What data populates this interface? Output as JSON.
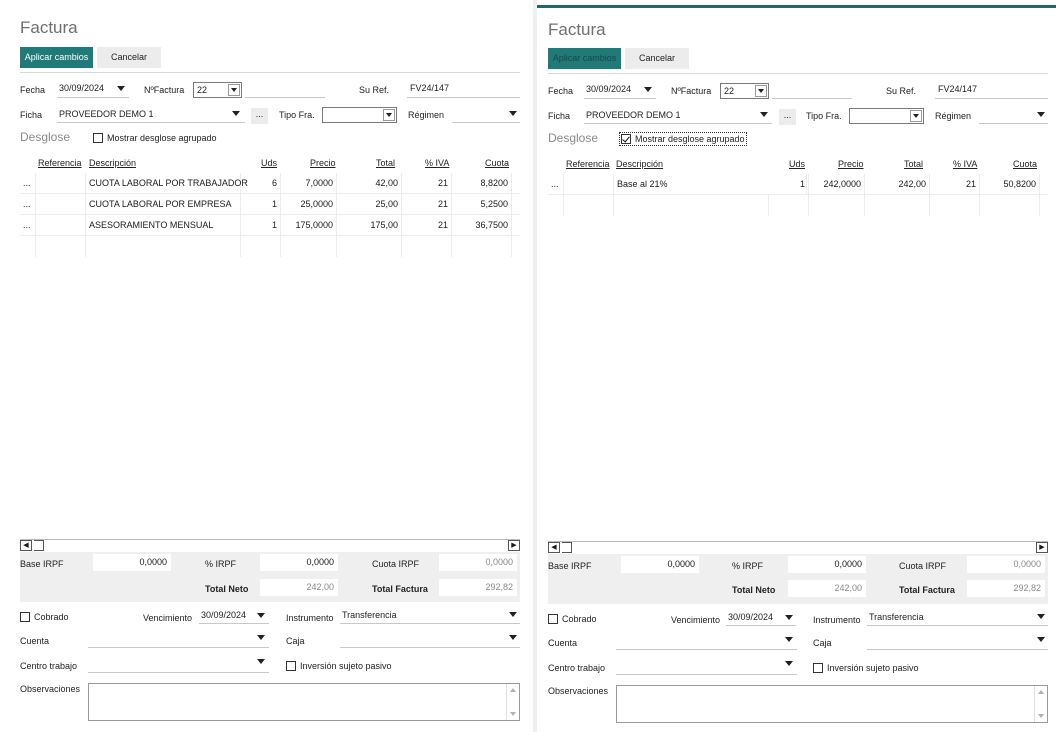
{
  "left": {
    "title": "Factura",
    "apply_label": "Aplicar cambios",
    "cancel_label": "Cancelar",
    "fecha_label": "Fecha",
    "fecha_value": "30/09/2024",
    "nfactura_label": "NºFactura",
    "nfactura_value": "22",
    "suref_label": "Su Ref.",
    "suref_value": "FV24/147",
    "ficha_label": "Ficha",
    "ficha_value": "PROVEEDOR DEMO 1",
    "dots": "...",
    "tipofra_label": "Tipo Fra.",
    "regimen_label": "Régimen",
    "desglose_label": "Desglose",
    "mostrar_label": "Mostrar desglose agrupado",
    "headers": {
      "ref": "Referencia",
      "desc": "Descripción",
      "uds": "Uds",
      "precio": "Precio",
      "total": "Total",
      "iva": "% IVA",
      "cuota": "Cuota"
    },
    "rows": [
      {
        "dots": "...",
        "desc": "CUOTA LABORAL POR TRABAJADOR",
        "uds": "6",
        "precio": "7,0000",
        "total": "42,00",
        "iva": "21",
        "cuota": "8,8200"
      },
      {
        "dots": "...",
        "desc": "CUOTA LABORAL POR EMPRESA",
        "uds": "1",
        "precio": "25,0000",
        "total": "25,00",
        "iva": "21",
        "cuota": "5,2500"
      },
      {
        "dots": "...",
        "desc": "ASESORAMIENTO MENSUAL",
        "uds": "1",
        "precio": "175,0000",
        "total": "175,00",
        "iva": "21",
        "cuota": "36,7500"
      }
    ],
    "base_irpf_label": "Base IRPF",
    "base_irpf_value": "0,0000",
    "pct_irpf_label": "% IRPF",
    "pct_irpf_value": "0,0000",
    "cuota_irpf_label": "Cuota IRPF",
    "cuota_irpf_value": "0,0000",
    "total_neto_label": "Total Neto",
    "total_neto_value": "242,00",
    "total_factura_label": "Total Factura",
    "total_factura_value": "292,82",
    "cobrado_label": "Cobrado",
    "vencimiento_label": "Vencimiento",
    "vencimiento_value": "30/09/2024",
    "instrumento_label": "Instrumento",
    "instrumento_value": "Transferencia",
    "cuenta_label": "Cuenta",
    "caja_label": "Caja",
    "centro_label": "Centro trabajo",
    "inversion_label": "Inversión sujeto pasivo",
    "observaciones_label": "Observaciones",
    "mostrar_checked": false
  },
  "right": {
    "title": "Factura",
    "apply_label": "Aplicar cambios",
    "cancel_label": "Cancelar",
    "fecha_label": "Fecha",
    "fecha_value": "30/09/2024",
    "nfactura_label": "NºFactura",
    "nfactura_value": "22",
    "suref_label": "Su Ref.",
    "suref_value": "FV24/147",
    "ficha_label": "Ficha",
    "ficha_value": "PROVEEDOR DEMO 1",
    "dots": "...",
    "tipofra_label": "Tipo Fra.",
    "regimen_label": "Régimen",
    "desglose_label": "Desglose",
    "mostrar_label": "Mostrar desglose agrupado",
    "headers": {
      "ref": "Referencia",
      "desc": "Descripción",
      "uds": "Uds",
      "precio": "Precio",
      "total": "Total",
      "iva": "% IVA",
      "cuota": "Cuota"
    },
    "rows": [
      {
        "dots": "...",
        "desc": "Base al 21%",
        "uds": "1",
        "precio": "242,0000",
        "total": "242,00",
        "iva": "21",
        "cuota": "50,8200"
      }
    ],
    "base_irpf_label": "Base IRPF",
    "base_irpf_value": "0,0000",
    "pct_irpf_label": "% IRPF",
    "pct_irpf_value": "0,0000",
    "cuota_irpf_label": "Cuota IRPF",
    "cuota_irpf_value": "0,0000",
    "total_neto_label": "Total Neto",
    "total_neto_value": "242,00",
    "total_factura_label": "Total Factura",
    "total_factura_value": "292,82",
    "cobrado_label": "Cobrado",
    "vencimiento_label": "Vencimiento",
    "vencimiento_value": "30/09/2024",
    "instrumento_label": "Instrumento",
    "instrumento_value": "Transferencia",
    "cuenta_label": "Cuenta",
    "caja_label": "Caja",
    "centro_label": "Centro trabajo",
    "inversion_label": "Inversión sujeto pasivo",
    "observaciones_label": "Observaciones",
    "mostrar_checked": true
  },
  "colors": {
    "accent": "#1f7a78",
    "accent_border": "#1b6b68",
    "muted_band": "#efefef"
  }
}
